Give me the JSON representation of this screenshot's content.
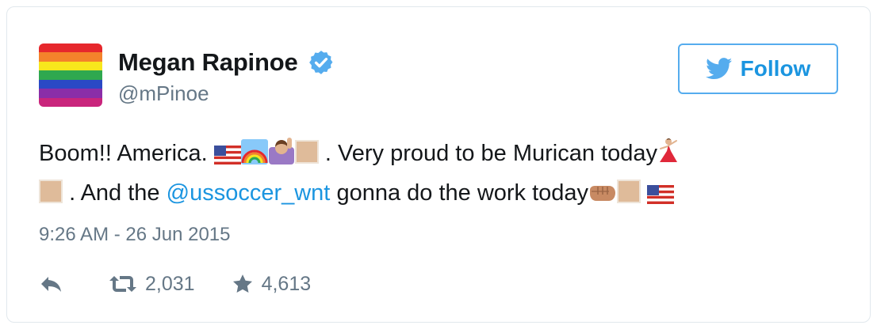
{
  "author": {
    "display_name": "Megan Rapinoe",
    "handle": "@mPinoe",
    "verified": true,
    "avatar_icon": "rainbow-flag-icon",
    "avatar_colors": [
      "#e6272c",
      "#f4822b",
      "#f8e71c",
      "#2fa84f",
      "#2a49c5",
      "#8a2ea8",
      "#c9257c"
    ]
  },
  "follow_button": {
    "label": "Follow",
    "icon": "twitter-bird-icon"
  },
  "tweet": {
    "line1_start": "Boom!! America.",
    "line1_mid": ". Very proud to be Murican today",
    "line2_start": ". And the",
    "mention": "@ussoccer_wnt",
    "line2_end": "gonna do the work today",
    "emojis": [
      "us-flag-icon",
      "rainbow-icon",
      "raising-hand-icon",
      "dancer-icon",
      "fist-icon"
    ]
  },
  "timestamp": "9:26 AM - 26 Jun 2015",
  "actions": {
    "reply_icon": "reply-icon",
    "retweet_icon": "retweet-icon",
    "retweet_count": "2,031",
    "like_icon": "star-icon",
    "like_count": "4,613"
  },
  "colors": {
    "accent": "#1b95e0",
    "follow_border": "#55acee",
    "muted": "#657786",
    "text": "#14171a",
    "border": "#e1e8ed"
  }
}
